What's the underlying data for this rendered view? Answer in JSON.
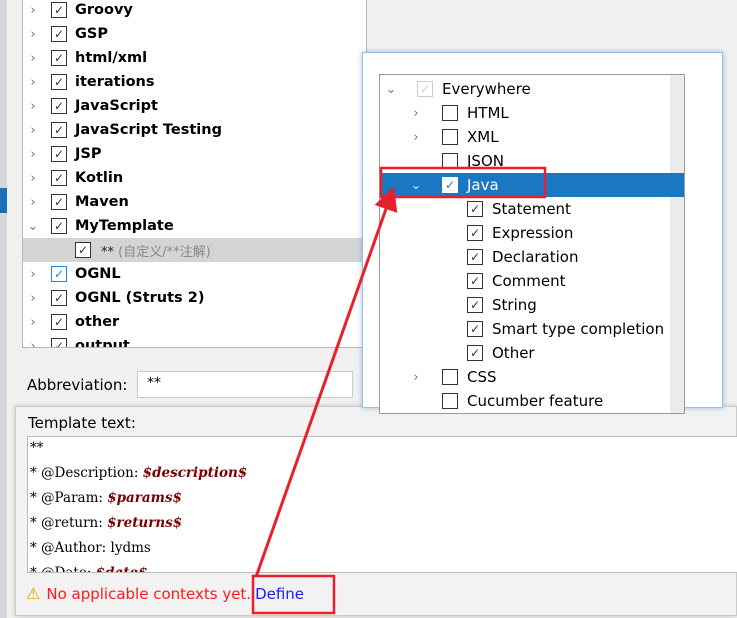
{
  "templates_tree": [
    {
      "label": "Groovy",
      "checked": true,
      "expanded": false
    },
    {
      "label": "GSP",
      "checked": true,
      "expanded": false
    },
    {
      "label": "html/xml",
      "checked": true,
      "expanded": false
    },
    {
      "label": "iterations",
      "checked": true,
      "expanded": false
    },
    {
      "label": "JavaScript",
      "checked": true,
      "expanded": false
    },
    {
      "label": "JavaScript Testing",
      "checked": true,
      "expanded": false
    },
    {
      "label": "JSP",
      "checked": true,
      "expanded": false
    },
    {
      "label": "Kotlin",
      "checked": true,
      "expanded": false
    },
    {
      "label": "Maven",
      "checked": true,
      "expanded": false
    },
    {
      "label": "MyTemplate",
      "checked": true,
      "expanded": true
    },
    {
      "label": "**",
      "desc": "(自定义/**注解)",
      "checked": true,
      "child": true,
      "selected": true
    },
    {
      "label": "OGNL",
      "checked": true,
      "expanded": false,
      "focused": true
    },
    {
      "label": "OGNL (Struts 2)",
      "checked": true,
      "expanded": false
    },
    {
      "label": "other",
      "checked": true,
      "expanded": false
    },
    {
      "label": "output",
      "checked": true,
      "expanded": false
    }
  ],
  "abbreviation": {
    "label": "Abbreviation:",
    "value": "**"
  },
  "template_text": {
    "label": "Template text:",
    "lines": [
      {
        "plain": "**",
        "var": ""
      },
      {
        "plain": "* @Description: ",
        "var": "$description$"
      },
      {
        "plain": "* @Param: ",
        "var": "$params$"
      },
      {
        "plain": "* @return: ",
        "var": "$returns$"
      },
      {
        "plain": "* @Author: lydms",
        "var": ""
      },
      {
        "plain": "* @Date: ",
        "var": "$date$"
      }
    ]
  },
  "warning": {
    "text": "No applicable contexts yet.",
    "link": "Define",
    "icon": "warning-icon"
  },
  "contexts_popup": [
    {
      "label": "Everywhere",
      "level": 0,
      "chev": "down",
      "state": "disabled"
    },
    {
      "label": "HTML",
      "level": 1,
      "chev": "right",
      "state": "unchecked"
    },
    {
      "label": "XML",
      "level": 1,
      "chev": "right",
      "state": "unchecked"
    },
    {
      "label": "JSON",
      "level": 1,
      "chev": "",
      "state": "unchecked"
    },
    {
      "label": "Java",
      "level": 1,
      "chev": "down",
      "state": "checked",
      "highlighted": true
    },
    {
      "label": "Statement",
      "level": 2,
      "chev": "",
      "state": "checked"
    },
    {
      "label": "Expression",
      "level": 2,
      "chev": "",
      "state": "checked"
    },
    {
      "label": "Declaration",
      "level": 2,
      "chev": "",
      "state": "checked"
    },
    {
      "label": "Comment",
      "level": 2,
      "chev": "",
      "state": "checked"
    },
    {
      "label": "String",
      "level": 2,
      "chev": "",
      "state": "checked"
    },
    {
      "label": "Smart type completion",
      "level": 2,
      "chev": "",
      "state": "checked"
    },
    {
      "label": "Other",
      "level": 2,
      "chev": "",
      "state": "checked"
    },
    {
      "label": "CSS",
      "level": 1,
      "chev": "right",
      "state": "unchecked"
    },
    {
      "label": "Cucumber feature",
      "level": 1,
      "chev": "",
      "state": "unchecked"
    }
  ],
  "colors": {
    "selection": "#1a78c2",
    "annotation": "#e8202a",
    "warning_text": "#ff1a1a",
    "link": "#1a1aff",
    "variable": "#7a0000"
  }
}
